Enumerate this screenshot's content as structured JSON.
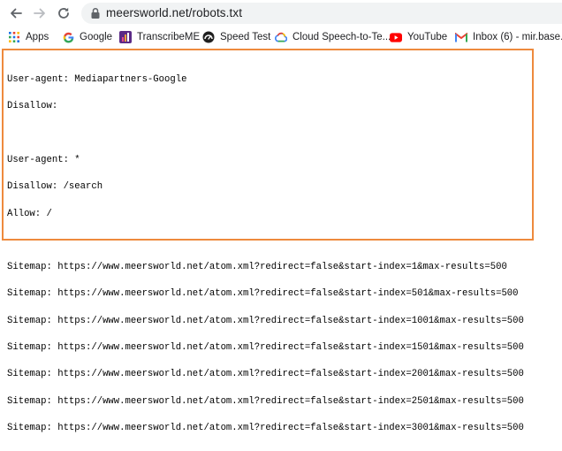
{
  "browser": {
    "url": "meersworld.net/robots.txt"
  },
  "bookmarks": [
    {
      "label": "Apps",
      "icon": "apps-grid-icon"
    },
    {
      "label": "Google",
      "icon": "google-g-icon"
    },
    {
      "label": "TranscribeME",
      "icon": "transcribeme-icon"
    },
    {
      "label": "Speed Test",
      "icon": "speedtest-icon"
    },
    {
      "label": "Cloud Speech-to-Te...",
      "icon": "google-cloud-icon"
    },
    {
      "label": "YouTube",
      "icon": "youtube-icon"
    },
    {
      "label": "Inbox (6) - mir.base...",
      "icon": "gmail-icon"
    }
  ],
  "robots": {
    "group1": {
      "user_agent": "User-agent: Mediapartners-Google",
      "disallow": "Disallow:"
    },
    "group2": {
      "user_agent": "User-agent: *",
      "disallow": "Disallow: /search",
      "allow": "Allow: /"
    },
    "sitemaps": [
      "Sitemap: https://www.meersworld.net/atom.xml?redirect=false&start-index=1&max-results=500",
      "Sitemap: https://www.meersworld.net/atom.xml?redirect=false&start-index=501&max-results=500",
      "Sitemap: https://www.meersworld.net/atom.xml?redirect=false&start-index=1001&max-results=500",
      "Sitemap: https://www.meersworld.net/atom.xml?redirect=false&start-index=1501&max-results=500",
      "Sitemap: https://www.meersworld.net/atom.xml?redirect=false&start-index=2001&max-results=500",
      "Sitemap: https://www.meersworld.net/atom.xml?redirect=false&start-index=2501&max-results=500",
      "Sitemap: https://www.meersworld.net/atom.xml?redirect=false&start-index=3001&max-results=500"
    ]
  },
  "colors": {
    "highlight_border": "#ee8a3d",
    "omnibox_bg": "#f1f3f4"
  }
}
